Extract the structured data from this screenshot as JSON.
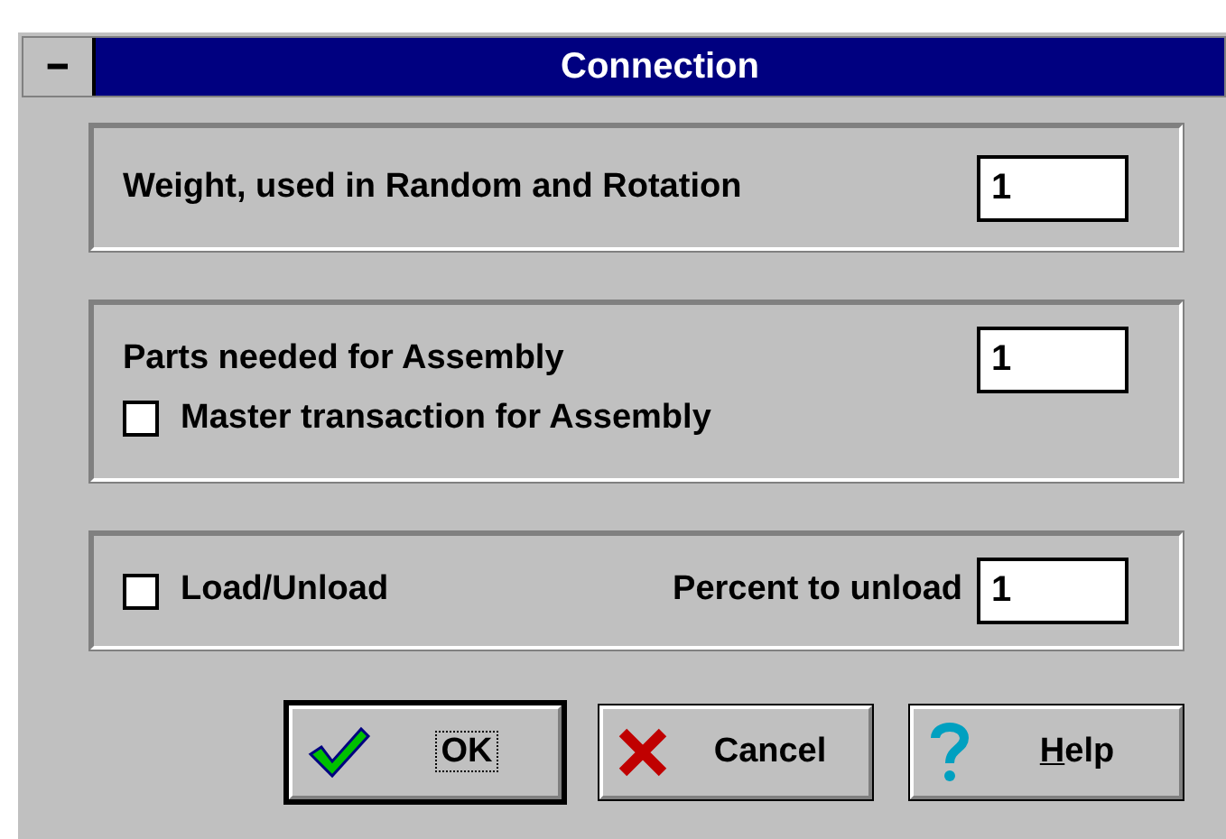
{
  "window": {
    "title": "Connection",
    "system_menu": "━"
  },
  "groups": [
    {
      "kind": "field",
      "label": "Weight, used in Random and Rotation",
      "value": "1"
    },
    {
      "kind": "field_check",
      "label": "Parts needed for Assembly",
      "value": "1",
      "check": {
        "label": "Master transaction for Assembly",
        "checked": false
      }
    },
    {
      "kind": "check_field",
      "check": {
        "label": "Load/Unload",
        "checked": false
      },
      "label": "Percent to unload",
      "value": "1"
    }
  ],
  "buttons": [
    {
      "kind": "ok",
      "label": "OK",
      "default": true
    },
    {
      "kind": "cancel",
      "label": "Cancel",
      "default": false
    },
    {
      "kind": "help",
      "label": "Help",
      "underline_first": true,
      "default": false
    }
  ]
}
